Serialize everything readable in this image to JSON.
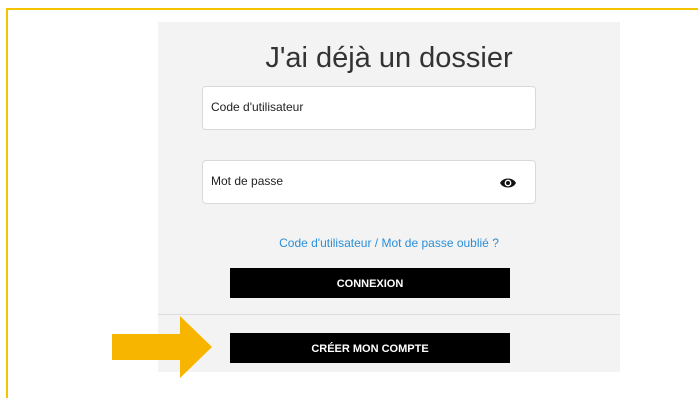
{
  "login": {
    "title": "J'ai déjà un dossier",
    "username_label": "Code d'utilisateur",
    "password_label": "Mot de passe",
    "forgot_link": "Code d'utilisateur / Mot de passe oublié ?",
    "connect_button": "CONNEXION",
    "create_account_button": "CRÉER MON COMPTE"
  },
  "icons": {
    "password_toggle": "eye-icon",
    "callout": "arrow-right-icon"
  },
  "colors": {
    "frame": "#f5c400",
    "arrow": "#f7b500",
    "link": "#2a8fd6",
    "button": "#000000",
    "panel": "#f3f3f3"
  }
}
